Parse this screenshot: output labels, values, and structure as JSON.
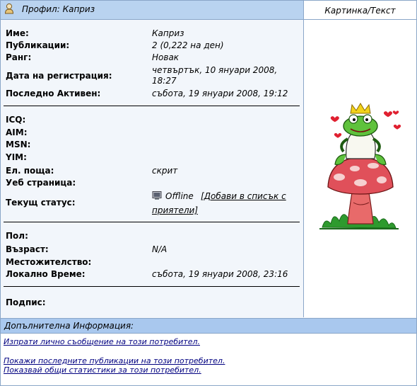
{
  "header": {
    "profile_title": "Профил: Каприз",
    "image_column_title": "Картинка/Текст"
  },
  "profile": {
    "name_label": "Име:",
    "name_value": "Каприз",
    "posts_label": "Публикации:",
    "posts_value": "2 (0,222 на ден)",
    "rank_label": "Ранг:",
    "rank_value": "Новак",
    "joined_label": "Дата на регистрация:",
    "joined_value_line1": "четвъртък, 10 януари 2008,",
    "joined_value_line2": "18:27",
    "last_active_label": "Последно Активен:",
    "last_active_value": "събота, 19 януари 2008, 19:12"
  },
  "contact": {
    "icq_label": "ICQ:",
    "aim_label": "AIM:",
    "msn_label": "MSN:",
    "yim_label": "YIM:",
    "email_label": "Ел. поща:",
    "email_value": "скрит",
    "website_label": "Уеб страница:",
    "status_label": "Текущ статус:",
    "status_value": "Offline",
    "add_friend_line1": "[Добави в списък с",
    "add_friend_line2": "приятели]"
  },
  "personal": {
    "gender_label": "Пол:",
    "age_label": "Възраст:",
    "age_value": "N/A",
    "location_label": "Местожителство:",
    "local_time_label": "Локално Време:",
    "local_time_value": "събота, 19 януари 2008, 23:16",
    "signature_label": "Подпис:"
  },
  "additional": {
    "title": "Допълнителна Информация:",
    "links": [
      "Изпрати лично съобщение на този потребител.",
      "Покажи последните публикации на този потребител.",
      "Показвай общи статистики за този потребител."
    ]
  },
  "icons": {
    "header_icon": "user-profile-icon",
    "status_icon": "computer-offline-icon",
    "avatar": "frog-prince-on-mushroom-avatar"
  }
}
